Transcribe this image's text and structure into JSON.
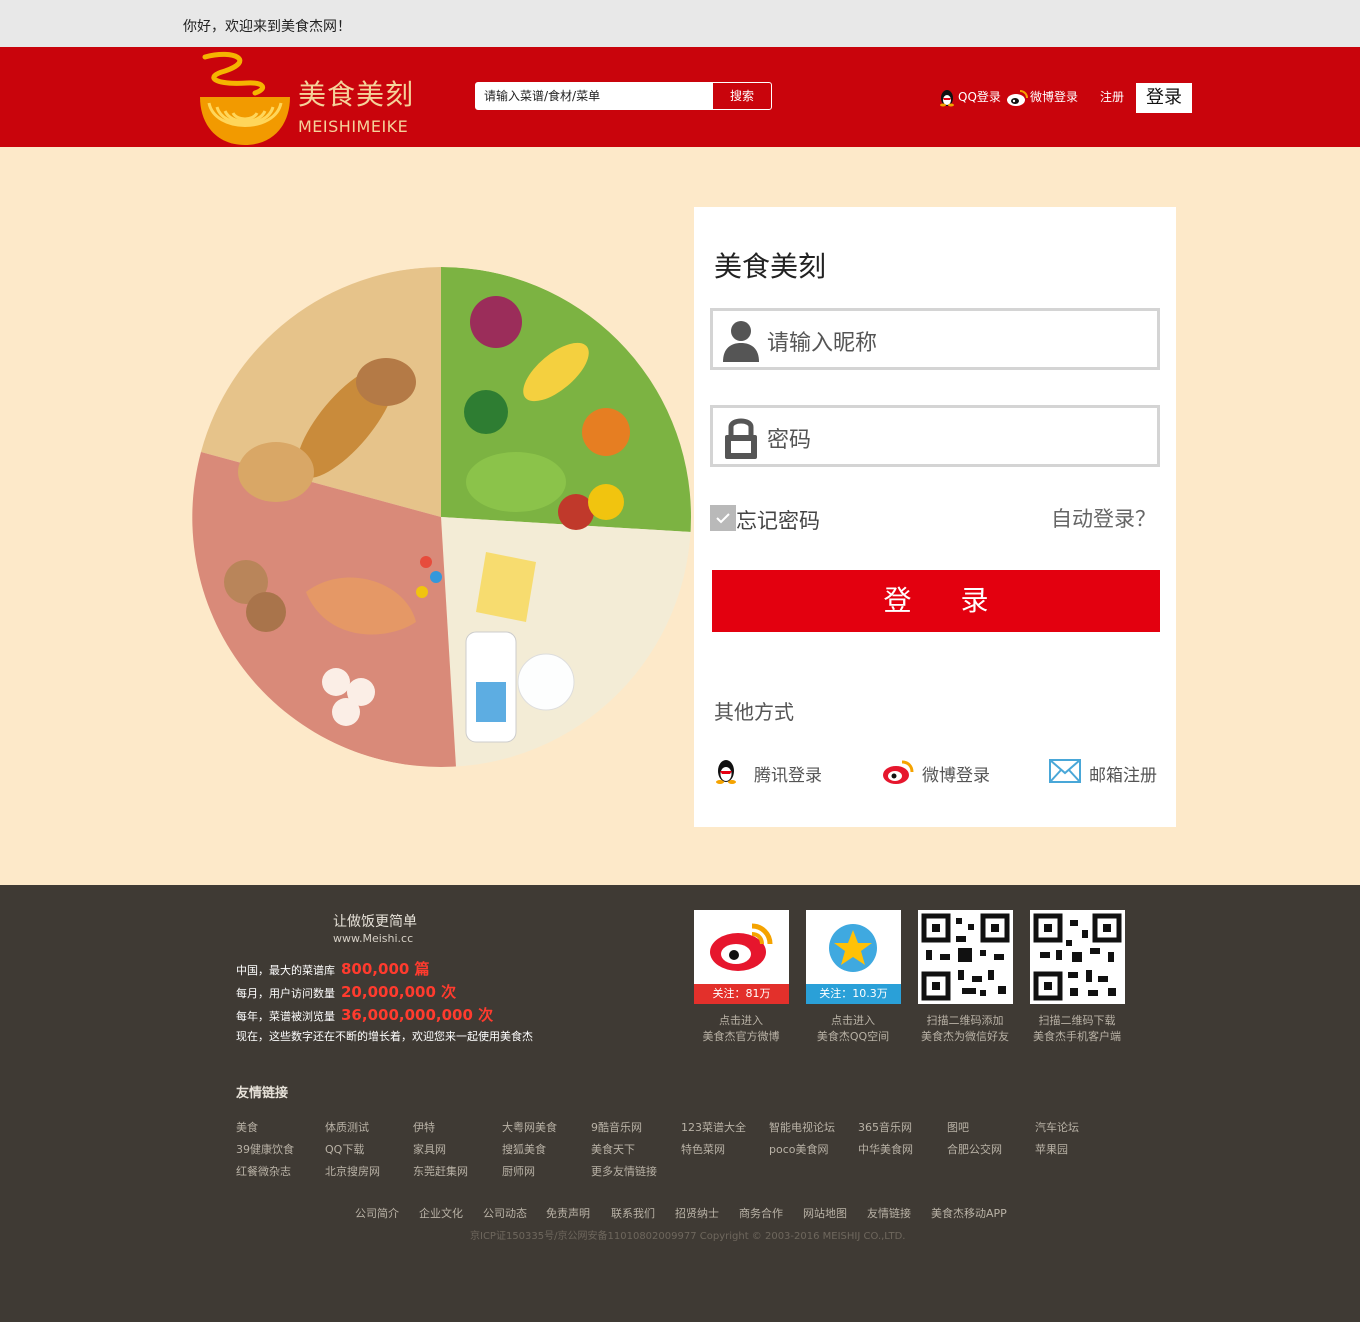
{
  "topbar": {
    "welcome": "你好，欢迎来到美食杰网！"
  },
  "header": {
    "logo_cn": "美食美刻",
    "logo_en": "MEISHIMEIKE",
    "search_placeholder": "请输入菜谱/食材/菜单",
    "search_button": "搜索",
    "qq_login": "QQ登录",
    "weibo_login": "微博登录",
    "register": "注册",
    "login": "登录"
  },
  "login_card": {
    "title": "美食美刻",
    "nickname_placeholder": "请输入昵称",
    "password_placeholder": "密码",
    "remember_label": "忘记密码",
    "auto_login": "自动登录？",
    "submit": "登 录",
    "other_methods": "其他方式",
    "social": [
      {
        "label": "腾讯登录",
        "icon": "qq-penguin-icon"
      },
      {
        "label": "微博登录",
        "icon": "weibo-icon"
      },
      {
        "label": "邮箱注册",
        "icon": "mail-icon"
      }
    ]
  },
  "footer": {
    "slogan": "让做饭更简单",
    "site": "www.Meishi.cc",
    "stats": [
      {
        "label": "中国，最大的菜谱库",
        "value": "800,000 篇"
      },
      {
        "label": "每月，用户访问数量",
        "value": "20,000,000 次"
      },
      {
        "label": "每年，菜谱被浏览量",
        "value": "36,000,000,000 次"
      }
    ],
    "stats_note": "现在，这些数字还在不断的增长着，欢迎您来一起使用美食杰",
    "tiles": [
      {
        "caption": "关注：81万",
        "line1": "点击进入",
        "line2": "美食杰官方微博",
        "caption_color": "#e3302b"
      },
      {
        "caption": "关注：10.3万",
        "line1": "点击进入",
        "line2": "美食杰QQ空间",
        "caption_color": "#2aa0d8"
      },
      {
        "caption": "",
        "line1": "扫描二维码添加",
        "line2": "美食杰为微信好友"
      },
      {
        "caption": "",
        "line1": "扫描二维码下载",
        "line2": "美食杰手机客户端"
      }
    ],
    "friend_links_title": "友情链接",
    "friend_links": [
      [
        "美食",
        "体质测试",
        "伊特",
        "大粤网美食",
        "9酷音乐网",
        "123菜谱大全",
        "智能电视论坛",
        "365音乐网",
        "图吧",
        "汽车论坛"
      ],
      [
        "39健康饮食",
        "QQ下载",
        "家具网",
        "搜狐美食",
        "美食天下",
        "特色菜网",
        "poco美食网",
        "中华美食网",
        "合肥公交网",
        "苹果园"
      ],
      [
        "红餐微杂志",
        "北京搜房网",
        "东莞赶集网",
        "厨师网",
        "更多友情链接"
      ]
    ],
    "bottom_links": [
      "公司简介",
      "企业文化",
      "公司动态",
      "免责声明",
      "联系我们",
      "招贤纳士",
      "商务合作",
      "网站地图",
      "友情链接",
      "美食杰移动APP"
    ],
    "icp": "京ICP证150335号/京公网安备11010802009977 Copyright © 2003-2016 MEISHIJ CO.,LTD."
  }
}
